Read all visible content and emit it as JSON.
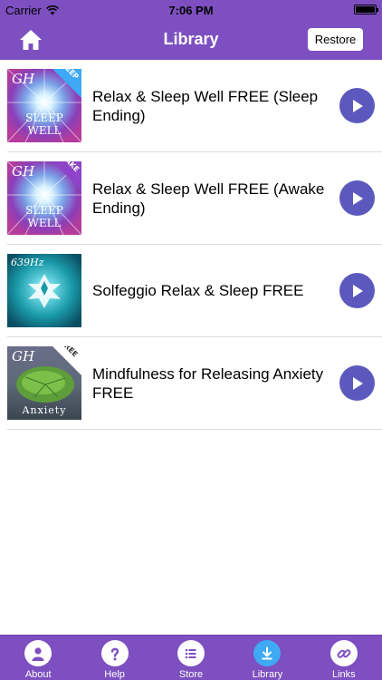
{
  "status_bar": {
    "carrier": "Carrier",
    "time": "7:06 PM"
  },
  "nav": {
    "title": "Library",
    "restore_label": "Restore",
    "home_icon": "home-icon"
  },
  "items": [
    {
      "title": "Relax & Sleep Well FREE (Sleep Ending)",
      "badge": "SLEEP",
      "logo": "GH",
      "art_caption": "SLEEP WELL"
    },
    {
      "title": "Relax & Sleep Well FREE (Awake Ending)",
      "badge": "AWAKE",
      "logo": "GH",
      "art_caption": "SLEEP WELL"
    },
    {
      "title": "Solfeggio Relax & Sleep FREE",
      "badge": "",
      "logo": "639Hz",
      "art_caption": ""
    },
    {
      "title": "Mindfulness for Releasing Anxiety FREE",
      "badge": "FREE",
      "logo": "GH",
      "art_caption": "Anxiety"
    }
  ],
  "tabs": [
    {
      "label": "About",
      "icon": "person-icon",
      "active": false
    },
    {
      "label": "Help",
      "icon": "question-icon",
      "active": false
    },
    {
      "label": "Store",
      "icon": "list-icon",
      "active": false
    },
    {
      "label": "Library",
      "icon": "download-icon",
      "active": true
    },
    {
      "label": "Links",
      "icon": "link-icon",
      "active": false
    }
  ],
  "colors": {
    "brand_purple": "#7d4fc0",
    "play_button": "#5b59bd",
    "active_tab": "#3fa9f5"
  }
}
